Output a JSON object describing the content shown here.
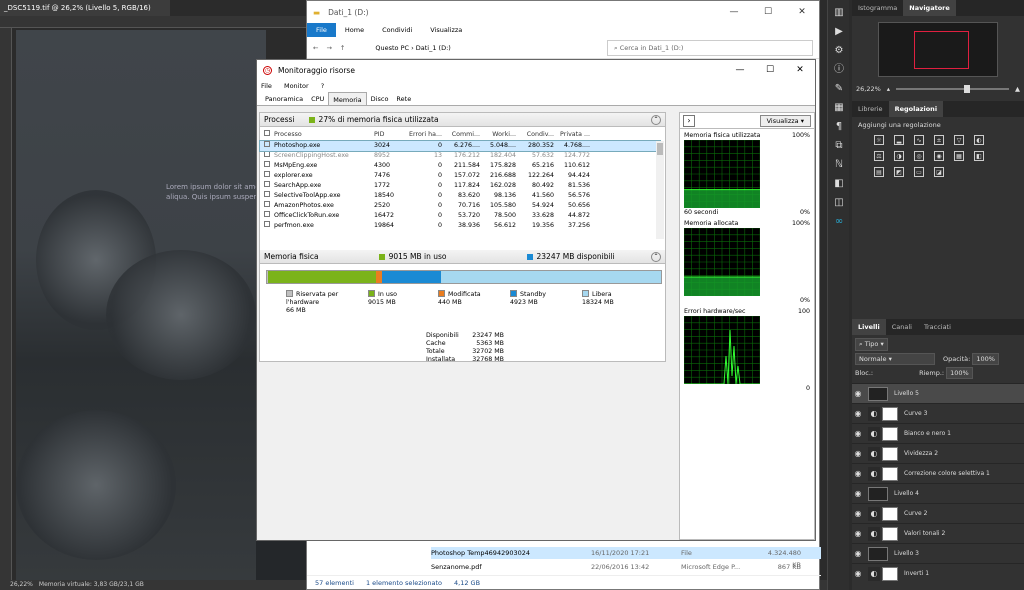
{
  "photoshop": {
    "doc_tab": "_DSC5119.tif @ 26,2% (Livello 5, RGB/16) *",
    "lorem_text": "Lorem ipsum dolor sit amet, co aliqua. Quis ipsum suspendisse",
    "status_zoom": "26,22%",
    "status_mem": "Memoria virtuale: 3,83 GB/23,1 GB",
    "panel_tabs_top": [
      "Istogramma",
      "Navigatore"
    ],
    "nav_zoom": "26,22%",
    "panel_tabs_mid": [
      "Librerie",
      "Regolazioni"
    ],
    "regolazioni_title": "Aggiungi una regolazione",
    "panel_tabs_layers": [
      "Livelli",
      "Canali",
      "Tracciati"
    ],
    "layer_filter": "Tipo",
    "blend_mode": "Normale",
    "opacity_label": "Opacità:",
    "opacity_value": "100%",
    "lock_label": "Bloc.:",
    "fill_label": "Riemp.:",
    "fill_value": "100%",
    "layers": [
      {
        "name": "Livello 5",
        "kind": "image",
        "selected": true
      },
      {
        "name": "Curve 3",
        "kind": "adj"
      },
      {
        "name": "Bianco e nero 1",
        "kind": "adj"
      },
      {
        "name": "Vividezza 2",
        "kind": "adj"
      },
      {
        "name": "Correzione colore selettiva 1",
        "kind": "adj"
      },
      {
        "name": "Livello 4",
        "kind": "image"
      },
      {
        "name": "Curve 2",
        "kind": "adj"
      },
      {
        "name": "Valori tonali 2",
        "kind": "adj"
      },
      {
        "name": "Livello 3",
        "kind": "image"
      },
      {
        "name": "Inverti 1",
        "kind": "adj"
      }
    ]
  },
  "explorer": {
    "title": "Dati_1 (D:)",
    "ribbon": [
      "File",
      "Home",
      "Condividi",
      "Visualizza"
    ],
    "path": [
      "Questo PC",
      "Dati_1 (D:)"
    ],
    "search_placeholder": "Cerca in Dati_1 (D:)",
    "files": [
      {
        "name": "Photoshop Temp46942903024",
        "date": "16/11/2020 17:21",
        "type": "File",
        "size": "4.324.480 KB",
        "selected": true
      },
      {
        "name": "Senzanome.pdf",
        "date": "22/06/2016 13:42",
        "type": "Microsoft Edge P...",
        "size": "867 KB"
      }
    ],
    "status_count": "57 elementi",
    "status_sel": "1 elemento selezionato",
    "status_size": "4,12 GB"
  },
  "monitor": {
    "title": "Monitoraggio risorse",
    "menu": [
      "File",
      "Monitor",
      "?"
    ],
    "tabs": [
      "Panoramica",
      "CPU",
      "Memoria",
      "Disco",
      "Rete"
    ],
    "active_tab": "Memoria",
    "proc_header": "Processi",
    "proc_summary": "27% di memoria fisica utilizzata",
    "columns": [
      "Processo",
      "PID",
      "Errori ha...",
      "Commi...",
      "Worki...",
      "Condiv...",
      "Privata ..."
    ],
    "processes": [
      {
        "name": "Photoshop.exe",
        "pid": "3024",
        "err": "0",
        "commit": "6.276....",
        "work": "5.048....",
        "share": "280.352",
        "priv": "4.768....",
        "sel": true
      },
      {
        "name": "ScreenClippingHost.exe",
        "pid": "8952",
        "err": "13",
        "commit": "176.212",
        "work": "182.404",
        "share": "57.632",
        "priv": "124.772",
        "dim": true
      },
      {
        "name": "MsMpEng.exe",
        "pid": "4300",
        "err": "0",
        "commit": "211.584",
        "work": "175.828",
        "share": "65.216",
        "priv": "110.612"
      },
      {
        "name": "explorer.exe",
        "pid": "7476",
        "err": "0",
        "commit": "157.072",
        "work": "216.688",
        "share": "122.264",
        "priv": "94.424"
      },
      {
        "name": "SearchApp.exe",
        "pid": "1772",
        "err": "0",
        "commit": "117.824",
        "work": "162.028",
        "share": "80.492",
        "priv": "81.536"
      },
      {
        "name": "SelectiveToolApp.exe",
        "pid": "18540",
        "err": "0",
        "commit": "83.620",
        "work": "98.136",
        "share": "41.560",
        "priv": "56.576"
      },
      {
        "name": "AmazonPhotos.exe",
        "pid": "2520",
        "err": "0",
        "commit": "70.716",
        "work": "105.580",
        "share": "54.924",
        "priv": "50.656"
      },
      {
        "name": "OfficeClickToRun.exe",
        "pid": "16472",
        "err": "0",
        "commit": "53.720",
        "work": "78.500",
        "share": "33.628",
        "priv": "44.872"
      },
      {
        "name": "perfmon.exe",
        "pid": "19864",
        "err": "0",
        "commit": "38.936",
        "work": "56.612",
        "share": "19.356",
        "priv": "37.256"
      }
    ],
    "mem_header": "Memoria fisica",
    "mem_inuse_summary": "9015 MB in uso",
    "mem_avail_summary": "23247 MB disponibili",
    "mem_bar": [
      {
        "label": "Riservata per l'hardware",
        "value": "66 MB",
        "mb": 66,
        "color": "#c0c0c0"
      },
      {
        "label": "In uso",
        "value": "9015 MB",
        "mb": 9015,
        "color": "#7bb31a"
      },
      {
        "label": "Modificata",
        "value": "440 MB",
        "mb": 440,
        "color": "#ea7d20"
      },
      {
        "label": "Standby",
        "value": "4923 MB",
        "mb": 4923,
        "color": "#1a8ad4"
      },
      {
        "label": "Libera",
        "value": "18324 MB",
        "mb": 18324,
        "color": "#a6d8f0"
      }
    ],
    "stats": [
      {
        "k": "Disponibili",
        "v": "23247 MB"
      },
      {
        "k": "Cache",
        "v": "5363 MB"
      },
      {
        "k": "Totale",
        "v": "32702 MB"
      },
      {
        "k": "Installata",
        "v": "32768 MB"
      }
    ],
    "view_button": "Visualizza",
    "graphs": [
      {
        "title": "Memoria fisica utilizzata",
        "max": "100%",
        "foot_l": "60 secondi",
        "foot_r": "0%",
        "level": 0.27
      },
      {
        "title": "Memoria allocata",
        "max": "100%",
        "foot_l": "",
        "foot_r": "0%",
        "level": 0.28
      },
      {
        "title": "Errori hardware/sec",
        "max": "100",
        "foot_l": "",
        "foot_r": "0",
        "level": 0.0
      }
    ]
  }
}
